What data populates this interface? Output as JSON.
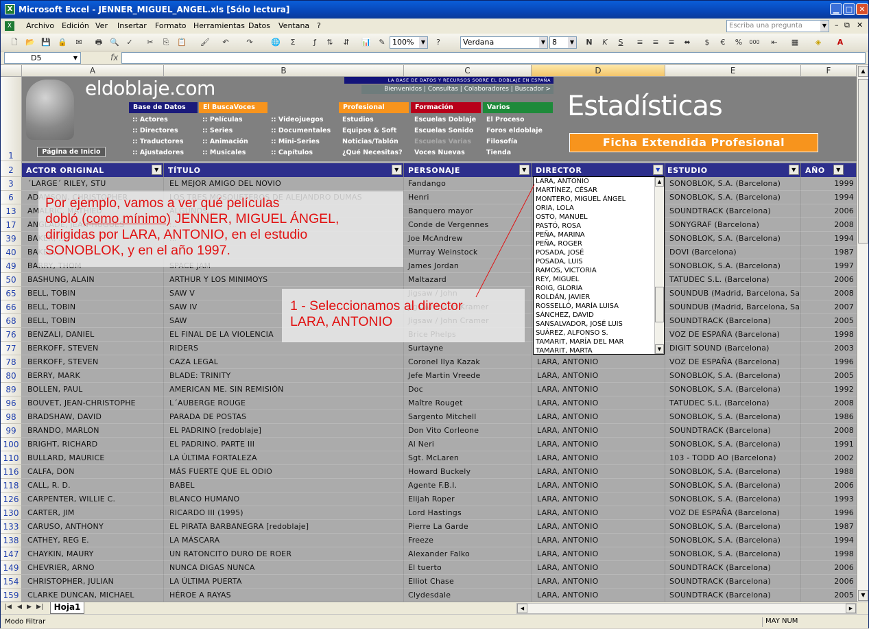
{
  "window": {
    "title": "Microsoft Excel - JENNER_MIGUEL_ANGEL.xls  [Sólo lectura]"
  },
  "menu": {
    "items": [
      "Archivo",
      "Edición",
      "Ver",
      "Insertar",
      "Formato",
      "Herramientas",
      "Datos",
      "Ventana",
      "?"
    ],
    "ask_placeholder": "Escriba una pregunta"
  },
  "toolbar": {
    "zoom": "100%",
    "font": "Verdana",
    "size": "8"
  },
  "formula_bar": {
    "cell_ref": "D5",
    "fx": "fx",
    "value": ""
  },
  "columns": [
    "A",
    "B",
    "C",
    "D",
    "E",
    "F"
  ],
  "banner": {
    "logo": "eldoblaje.com",
    "tagline": "LA BASE DE DATOS Y RECURSOS SOBRE EL DOBLAJE EN ESPAÑA",
    "topnav": "Bienvenidos | Consultas | Colaboradores | Buscador >",
    "groups": [
      "Base de Datos",
      "El BuscaVoces",
      "Profesional",
      "Formación",
      "Varios"
    ],
    "col1": [
      ":: Actores",
      ":: Directores",
      ":: Traductores",
      ":: Ajustadores"
    ],
    "col2": [
      ":: Películas",
      ":: Series",
      ":: Animación",
      ":: Musicales"
    ],
    "col3": [
      ":: Videojuegos",
      ":: Documentales",
      ":: Mini-Series",
      ":: Capítulos"
    ],
    "col4": [
      "Estudios",
      "Equipos & Soft",
      "Noticias/Tablón",
      "¿Qué Necesitas?"
    ],
    "col5": [
      "Escuelas Doblaje",
      "Escuelas Sonido",
      "Escuelas Varias",
      "Voces Nuevas"
    ],
    "col6": [
      "El Proceso",
      "Foros eldoblaje",
      "Filosofía",
      "Tienda"
    ],
    "stats": "Estadísticas",
    "ficha": "Ficha Extendida Profesional",
    "inicio": "Página de Inicio"
  },
  "headers": [
    "ACTOR ORIGINAL",
    "TÍTULO",
    "PERSONAJE",
    "DIRECTOR",
    "ESTUDIO",
    "AÑO"
  ],
  "header_row_num": "2",
  "banner_row_num": "1",
  "rows": [
    [
      "3",
      "´LARGE´ RILEY, STU",
      "EL MEJOR AMIGO DEL NOVIO",
      "Fandango",
      "",
      "SONOBLOK, S.A. (Barcelona)",
      "1999"
    ],
    [
      "6",
      "ADAMSON, CHRISTOPHER",
      "LOS TRES MOSQUETEROS DE ALEJANDRO DUMAS",
      "Henri",
      "",
      "SONOBLOK, S.A. (Barcelona)",
      "1994"
    ],
    [
      "13",
      "AMALRIC, MATHIEU",
      "ALGUNOS...",
      "Banquero mayor",
      "",
      "SOUNDTRACK (Barcelona)",
      "2006"
    ],
    [
      "17",
      "ANGLADE, JEAN-HUGUES",
      "...",
      "Conde de Vergennes",
      "",
      "SONYGRAF (Barcelona)",
      "2008"
    ],
    [
      "39",
      "BAKER, ...",
      "...",
      "Joe McAndrew",
      "",
      "SONOBLOK, S.A. (Barcelona)",
      "1994"
    ],
    [
      "40",
      "BAKER, ...",
      "...",
      "Murray Weinstock",
      "",
      "DOVI (Barcelona)",
      "1987"
    ],
    [
      "49",
      "BARRY, THOM",
      "SPACE JAM",
      "James Jordan",
      "",
      "SONOBLOK, S.A. (Barcelona)",
      "1997"
    ],
    [
      "50",
      "BASHUNG, ALAIN",
      "ARTHUR Y LOS MINIMOYS",
      "Maltazard",
      "",
      "TATUDEC S.L. (Barcelona)",
      "2006"
    ],
    [
      "65",
      "BELL, TOBIN",
      "SAW V",
      "Jigsaw / John",
      "",
      "SOUNDUB (Madrid, Barcelona, Sa",
      "2008"
    ],
    [
      "66",
      "BELL, TOBIN",
      "SAW IV",
      "Jigsaw / John Kramer",
      "",
      "SOUNDUB (Madrid, Barcelona, Sa",
      "2007"
    ],
    [
      "68",
      "BELL, TOBIN",
      "SAW",
      "Jigsaw / John Cramer",
      "",
      "SOUNDTRACK (Barcelona)",
      "2005"
    ],
    [
      "76",
      "BENZALI, DANIEL",
      "EL FINAL DE LA VIOLENCIA",
      "Brice Phelps",
      "",
      "VOZ DE ESPAÑA (Barcelona)",
      "1998"
    ],
    [
      "77",
      "BERKOFF, STEVEN",
      "RIDERS",
      "Surtayne",
      "",
      "DIGIT SOUND (Barcelona)",
      "2003"
    ],
    [
      "78",
      "BERKOFF, STEVEN",
      "CAZA LEGAL",
      "Coronel Ilya Kazak",
      "LARA, ANTONIO",
      "VOZ DE ESPAÑA (Barcelona)",
      "1996"
    ],
    [
      "80",
      "BERRY, MARK",
      "BLADE: TRINITY",
      "Jefe Martin Vreede",
      "LARA, ANTONIO",
      "SONOBLOK, S.A. (Barcelona)",
      "2005"
    ],
    [
      "89",
      "BOLLEN, PAUL",
      "AMERICAN ME. SIN REMISIÓN",
      "Doc",
      "LARA, ANTONIO",
      "SONOBLOK, S.A. (Barcelona)",
      "1992"
    ],
    [
      "96",
      "BOUVET, JEAN-CHRISTOPHE",
      "L´AUBERGE ROUGE",
      "Maître Rouget",
      "LARA, ANTONIO",
      "TATUDEC S.L. (Barcelona)",
      "2008"
    ],
    [
      "98",
      "BRADSHAW, DAVID",
      "PARADA DE POSTAS",
      "Sargento Mitchell",
      "LARA, ANTONIO",
      "SONOBLOK, S.A. (Barcelona)",
      "1986"
    ],
    [
      "99",
      "BRANDO, MARLON",
      "EL PADRINO [redoblaje]",
      "Don Vito Corleone",
      "LARA, ANTONIO",
      "SOUNDTRACK (Barcelona)",
      "2008"
    ],
    [
      "100",
      "BRIGHT, RICHARD",
      "EL PADRINO. PARTE III",
      "Al Neri",
      "LARA, ANTONIO",
      "SONOBLOK, S.A. (Barcelona)",
      "1991"
    ],
    [
      "110",
      "BULLARD, MAURICE",
      "LA ÚLTIMA FORTALEZA",
      "Sgt. McLaren",
      "LARA, ANTONIO",
      "103 - TODD AO (Barcelona)",
      "2002"
    ],
    [
      "116",
      "CALFA, DON",
      "MÁS FUERTE QUE EL ODIO",
      "Howard Buckely",
      "LARA, ANTONIO",
      "SONOBLOK, S.A. (Barcelona)",
      "1988"
    ],
    [
      "118",
      "CALL, R. D.",
      "BABEL",
      "Agente F.B.I.",
      "LARA, ANTONIO",
      "SONOBLOK, S.A. (Barcelona)",
      "2006"
    ],
    [
      "126",
      "CARPENTER, WILLIE C.",
      "BLANCO HUMANO",
      "Elijah Roper",
      "LARA, ANTONIO",
      "SONOBLOK, S.A. (Barcelona)",
      "1993"
    ],
    [
      "130",
      "CARTER, JIM",
      "RICARDO III (1995)",
      "Lord Hastings",
      "LARA, ANTONIO",
      "VOZ DE ESPAÑA (Barcelona)",
      "1996"
    ],
    [
      "133",
      "CARUSO, ANTHONY",
      "EL PIRATA BARBANEGRA [redoblaje]",
      "Pierre La Garde",
      "LARA, ANTONIO",
      "SONOBLOK, S.A. (Barcelona)",
      "1987"
    ],
    [
      "138",
      "CATHEY, REG E.",
      "LA MÁSCARA",
      "Freeze",
      "LARA, ANTONIO",
      "SONOBLOK, S.A. (Barcelona)",
      "1994"
    ],
    [
      "147",
      "CHAYKIN, MAURY",
      "UN RATONCITO DURO DE ROER",
      "Alexander Falko",
      "LARA, ANTONIO",
      "SONOBLOK, S.A. (Barcelona)",
      "1998"
    ],
    [
      "149",
      "CHEVRIER, ARNO",
      "NUNCA DIGAS NUNCA",
      "El tuerto",
      "LARA, ANTONIO",
      "SOUNDTRACK (Barcelona)",
      "2006"
    ],
    [
      "154",
      "CHRISTOPHER, JULIAN",
      "LA ÚLTIMA PUERTA",
      "Elliot Chase",
      "LARA, ANTONIO",
      "SOUNDTRACK (Barcelona)",
      "2006"
    ],
    [
      "159",
      "CLARKE DUNCAN, MICHAEL",
      "HÉROE A RAYAS",
      "Clydesdale",
      "LARA, ANTONIO",
      "SOUNDTRACK (Barcelona)",
      "2005"
    ]
  ],
  "dropdown": [
    "LARA, ANTONIO",
    "MARTÍNEZ, CÉSAR",
    "MONTERO, MIGUEL ÁNGEL",
    "ORIA, LOLA",
    "OSTO, MANUEL",
    "PASTÓ, ROSA",
    "PEÑA, MARINA",
    "PEÑA, ROGER",
    "POSADA, JOSÉ",
    "POSADA, LUIS",
    "RAMOS, VICTORIA",
    "REY, MIGUEL",
    "ROIG, GLORIA",
    "ROLDÁN, JAVIER",
    "ROSSELLÓ, MARÍA LUISA",
    "SÁNCHEZ, DAVID",
    "SANSALVADOR, JOSÉ LUIS",
    "SUÁREZ, ALFONSO S.",
    "TAMARIT, MARÍA DEL MAR",
    "TAMARIT, MARTA"
  ],
  "note1": {
    "line1": "Por ejemplo, vamos a ver qué películas",
    "line2a": "dobló ",
    "line2b": "(como mínimo)",
    "line2c": " JENNER, MIGUEL ÁNGEL,",
    "line3": "dirigidas por LARA, ANTONIO, en el estudio",
    "line4": "SONOBLOK, y en el año 1997."
  },
  "note2": {
    "line1": "1 - Seleccionamos al director",
    "line2": "LARA, ANTONIO"
  },
  "sheet_tab": "Hoja1",
  "status": {
    "mode": "Modo Filtrar",
    "indicators": "MAY NUM"
  }
}
